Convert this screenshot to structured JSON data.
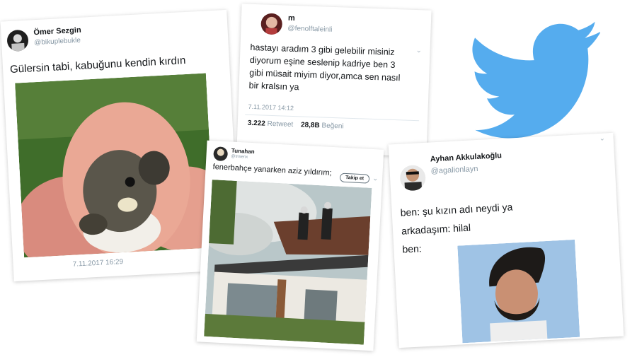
{
  "tweets": [
    {
      "name": "Ömer Sezgin",
      "handle": "@bikuplebukle",
      "text": "Gülersin tabi, kabuğunu kendin kırdın",
      "timestamp": "7.11.2017 16:29",
      "photo": "baby-turtle-hatching-photo"
    },
    {
      "name": "m",
      "handle": "@fenolftaleinli",
      "text": "hastayı aradım 3 gibi gelebilir misiniz\ndiyorum eşine seslenip kadriye ben 3\ngibi müsait miyim diyor,amca sen nasıl\nbir kralsın ya",
      "timestamp": "7.11.2017 14:12",
      "retweets_count": "3.222",
      "retweets_label": "Retweet",
      "likes_count": "28,8B",
      "likes_label": "Beğeni"
    },
    {
      "name": "Tunahan",
      "handle": "@tnsenx",
      "text": "fenerbahçe yanarken aziz yıldırım;",
      "follow_label": "Takip et",
      "photo": "firefighters-on-roof-man-sunbathing-photo"
    },
    {
      "name": "Ayhan Akkulakoğlu",
      "handle": "@agalionlayn",
      "text": "ben: şu kızın adı neydi ya\narkadaşım: hilal\nben:",
      "photo": "man-with-crescent-hair-photo"
    }
  ],
  "logo": {
    "icon": "twitter-bird-icon",
    "color": "#55acee"
  }
}
